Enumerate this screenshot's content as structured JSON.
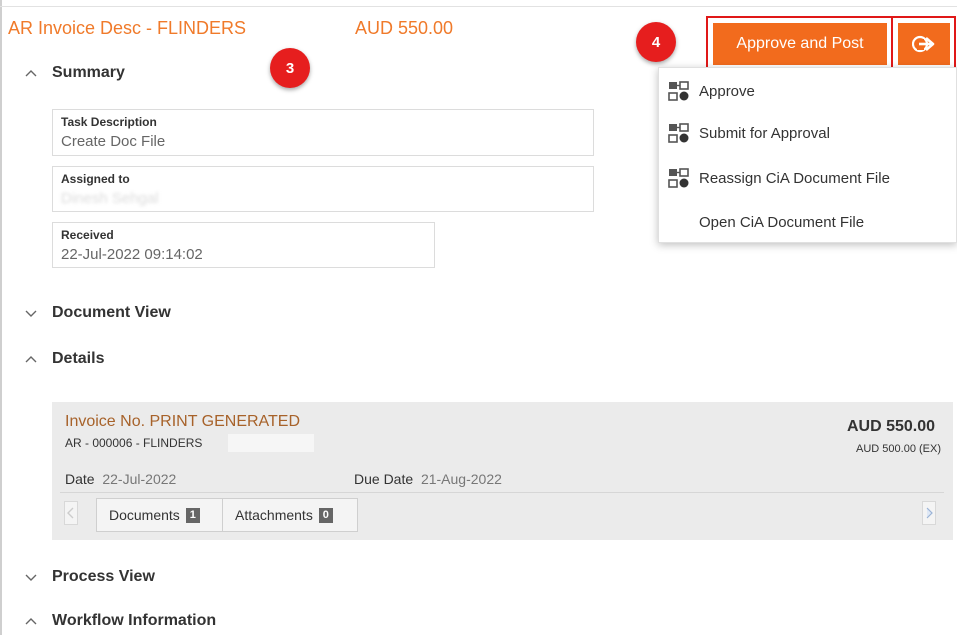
{
  "header": {
    "title": "AR Invoice Desc - FLINDERS",
    "amount": "AUD 550.00"
  },
  "badges": {
    "three": "3",
    "four": "4"
  },
  "actions": {
    "approve_post_label": "Approve and Post",
    "split_icon": "workflow-arrow-icon"
  },
  "dropdown": {
    "items": [
      {
        "label": "Approve",
        "icon": "workflow-icon"
      },
      {
        "label": "Submit for Approval",
        "icon": "workflow-icon"
      },
      {
        "label": "Reassign CiA Document File",
        "icon": "workflow-icon"
      },
      {
        "label": "Open CiA Document File",
        "icon": ""
      }
    ]
  },
  "summary": {
    "heading": "Summary",
    "task_description": {
      "label": "Task Description",
      "value": "Create Doc File"
    },
    "assigned_to": {
      "label": "Assigned to",
      "value": "Dinesh Sehgal"
    },
    "received": {
      "label": "Received",
      "value": "22-Jul-2022 09:14:02"
    }
  },
  "sections": {
    "document_view": "Document View",
    "details": "Details",
    "process_view": "Process View",
    "workflow_information": "Workflow Information"
  },
  "invoice": {
    "title": "Invoice No. PRINT GENERATED",
    "subtitle": "AR - 000006 - FLINDERS",
    "amount": "AUD 550.00",
    "amount_ex": "AUD 500.00 (EX)",
    "date_label": "Date",
    "date_value": "22-Jul-2022",
    "due_label": "Due Date",
    "due_value": "21-Aug-2022",
    "tabs": [
      {
        "label": "Documents",
        "count": "1"
      },
      {
        "label": "Attachments",
        "count": "0"
      }
    ]
  },
  "colors": {
    "accent": "#f26b1d",
    "title_orange": "#f07a2a",
    "highlight_red": "#e01818",
    "invoice_brown": "#a7622a"
  }
}
